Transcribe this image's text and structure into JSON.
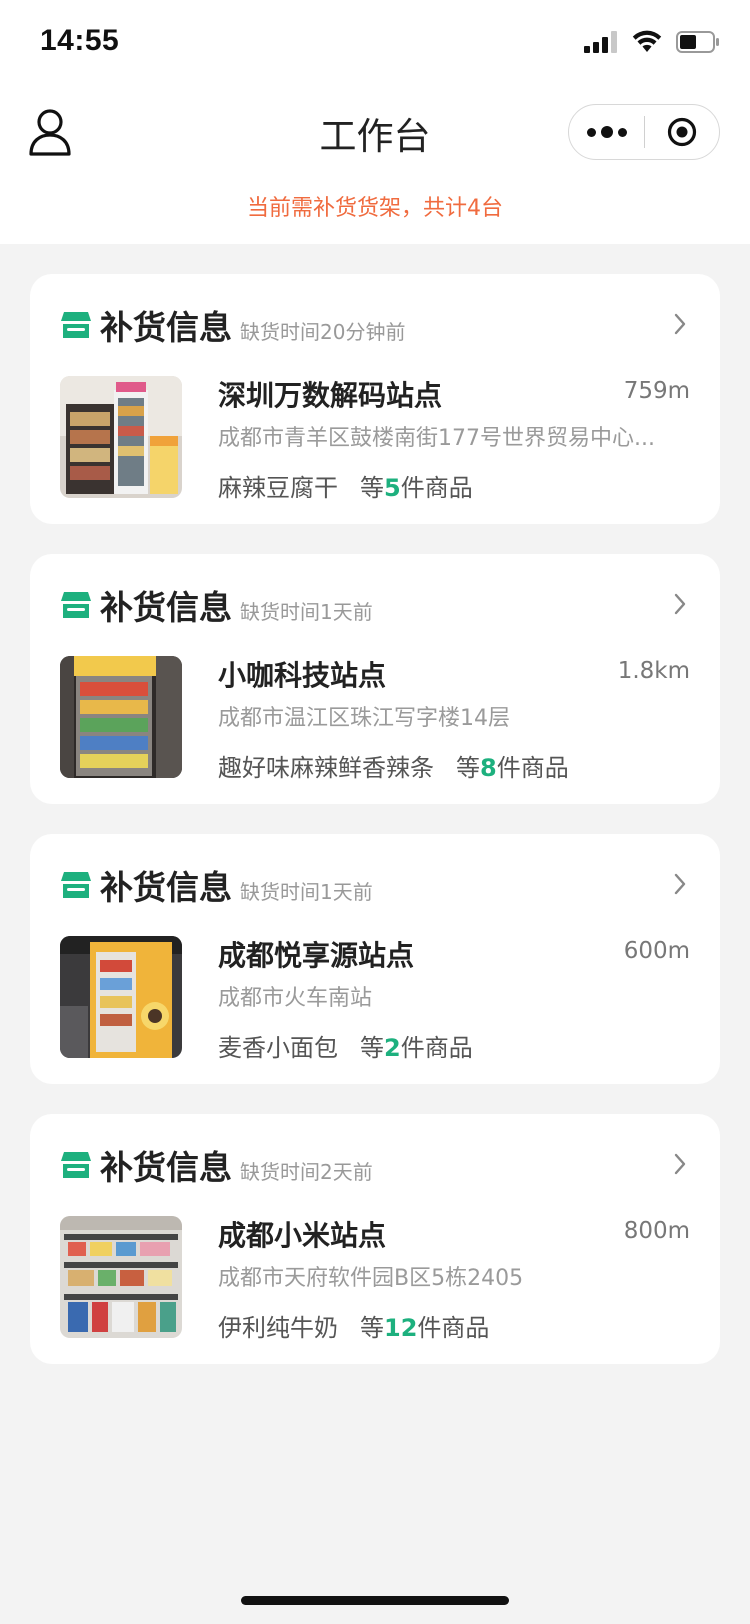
{
  "status_bar": {
    "time": "14:55"
  },
  "nav": {
    "title": "工作台"
  },
  "notice": "当前需补货货架，共计4台",
  "colors": {
    "accent_green": "#1db07e",
    "notice_orange": "#f06b3f"
  },
  "cards": [
    {
      "title": "补货信息",
      "time": "缺货时间20分钟前",
      "site": "深圳万数解码站点",
      "distance": "759m",
      "address": "成都市青羊区鼓楼南街177号世界贸易中心...",
      "product": "麻辣豆腐干",
      "prefix": "等",
      "count": "5",
      "suffix": "件商品"
    },
    {
      "title": "补货信息",
      "time": "缺货时间1天前",
      "site": "小咖科技站点",
      "distance": "1.8km",
      "address": "成都市温江区珠江写字楼14层",
      "product": "趣好味麻辣鲜香辣条",
      "prefix": "等",
      "count": "8",
      "suffix": "件商品"
    },
    {
      "title": "补货信息",
      "time": "缺货时间1天前",
      "site": "成都悦享源站点",
      "distance": "600m",
      "address": "成都市火车南站",
      "product": "麦香小面包",
      "prefix": "等",
      "count": "2",
      "suffix": "件商品"
    },
    {
      "title": "补货信息",
      "time": "缺货时间2天前",
      "site": "成都小米站点",
      "distance": "800m",
      "address": "成都市天府软件园B区5栋2405",
      "product": "伊利纯牛奶",
      "prefix": "等",
      "count": "12",
      "suffix": "件商品"
    }
  ]
}
